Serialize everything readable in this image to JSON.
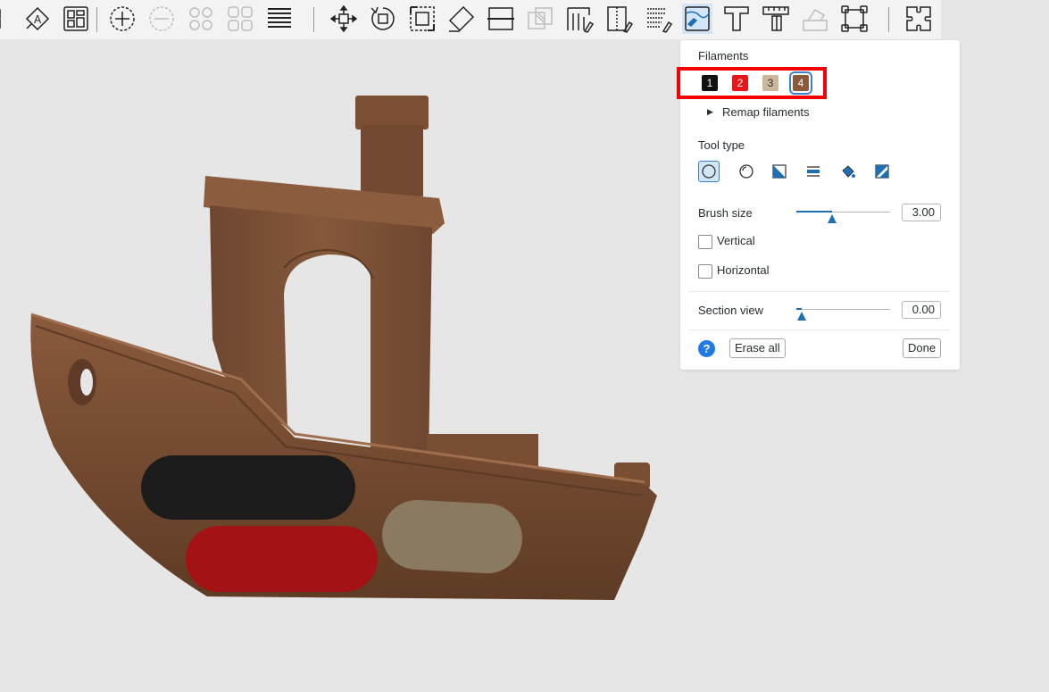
{
  "toolbar": {
    "icons": [
      "arrange-icon",
      "orient-icon",
      "plate-layout-icon",
      "add-plate-icon",
      "remove-plate-icon",
      "split-objects-icon",
      "split-parts-icon",
      "layers-icon",
      "move-icon",
      "rotate-icon",
      "scale-icon",
      "lay-on-face-icon",
      "cut-icon",
      "boolean-icon",
      "support-paint-icon",
      "seam-paint-icon",
      "fuzzy-skin-icon",
      "color-paint-icon",
      "text-icon",
      "measure-icon",
      "brim-ears-icon",
      "simplify-icon",
      "assembly-icon"
    ]
  },
  "panel": {
    "filaments_label": "Filaments",
    "filaments": [
      {
        "number": "1",
        "color": "#111111",
        "text_color": "#ffffff"
      },
      {
        "number": "2",
        "color": "#e8151b",
        "text_color": "#ffffff"
      },
      {
        "number": "3",
        "color": "#cbb89a",
        "text_color": "#262e30"
      },
      {
        "number": "4",
        "color": "#8a5a3b",
        "text_color": "#ffffff"
      }
    ],
    "selected_filament": "4",
    "remap_label": "Remap filaments",
    "tool_type_label": "Tool type",
    "tool_types": [
      "circle-brush-icon",
      "sphere-brush-icon",
      "triangle-brush-icon",
      "height-range-icon",
      "fill-bucket-icon",
      "gap-fill-icon"
    ],
    "brush_size_label": "Brush size",
    "brush_size_value": "3.00",
    "brush_size_fraction": 0.38,
    "vertical_label": "Vertical",
    "horizontal_label": "Horizontal",
    "section_view_label": "Section view",
    "section_view_value": "0.00",
    "section_view_fraction": 0.06,
    "help_label": "?",
    "erase_all_label": "Erase all",
    "done_label": "Done"
  },
  "colors": {
    "accent": "#1f6fb5",
    "highlight": "#f50000",
    "model_brown": "#7a4e33"
  }
}
